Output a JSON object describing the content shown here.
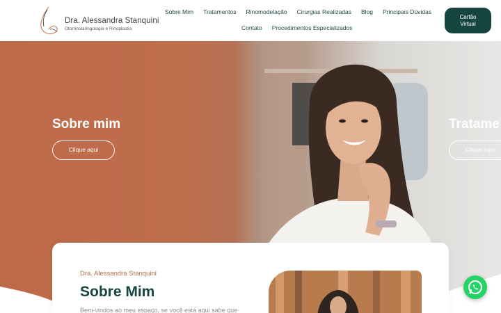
{
  "brand": {
    "name": "Dra. Alessandra Stanquini",
    "subtitle": "Otorrinolaringologia e Rinoplastia",
    "logo_icon": "nose-profile-icon"
  },
  "nav": {
    "row1": [
      "Sobre Mim",
      "Tratamentos",
      "Rinomodelação",
      "Cirurgias Realizadas",
      "Blog",
      "Principais Dúvidas"
    ],
    "row2": [
      "Contato",
      "Procedimentos Especializados"
    ]
  },
  "cta": {
    "line1": "Cartão",
    "line2": "Virtual"
  },
  "hero": {
    "slides": [
      {
        "title": "Sobre mim",
        "button": "Clique aqui"
      },
      {
        "title": "Tratame",
        "button": "Clique aqui"
      }
    ]
  },
  "about": {
    "overline": "Dra. Alessandra Stanquini",
    "title": "Sobre Mim",
    "text": "Bem-vindos ao meu espaço, se você está aqui sabe que"
  },
  "whatsapp": {
    "icon": "whatsapp-icon"
  },
  "colors": {
    "accent": "#bd6a49",
    "primary": "#164540",
    "whatsapp": "#25d366"
  }
}
